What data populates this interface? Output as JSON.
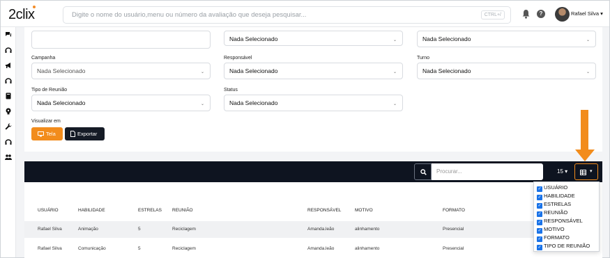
{
  "app": {
    "logo": "2clix"
  },
  "header": {
    "search_placeholder": "Digite o nome do usuário,menu ou número da avaliação que deseja pesquisar...",
    "shortcut": "CTRL+/",
    "user_name": "Rafael Silva"
  },
  "filters": {
    "row0": [
      {
        "value": ""
      },
      {
        "value": "Nada Selecionado"
      },
      {
        "value": "Nada Selecionado"
      }
    ],
    "campanha": {
      "label": "Campanha",
      "value": "Nada Selecionado"
    },
    "responsavel": {
      "label": "Responsável",
      "value": "Nada Selecionado"
    },
    "turno": {
      "label": "Turno",
      "value": "Nada Selecionado"
    },
    "tipo_reuniao": {
      "label": "Tipo de Reunião",
      "value": "Nada Selecionado"
    },
    "status": {
      "label": "Status",
      "value": "Nada Selecionado"
    },
    "visualizar_label": "Visualizar em",
    "btn_tela": "Tela",
    "btn_exportar": "Exportar"
  },
  "table": {
    "search_placeholder": "Procurar...",
    "page_size": "15",
    "columns": [
      "USUÁRIO",
      "HABILIDADE",
      "ESTRELAS",
      "REUNIÃO",
      "RESPONSÁVEL",
      "MOTIVO",
      "FORMATO"
    ],
    "rows": [
      [
        "Rafael Silva",
        "Animação",
        "5",
        "Reciclagem",
        "Amanda.leão",
        "alinhamento",
        "Presencial"
      ],
      [
        "Rafael Silva",
        "Comunicação",
        "5",
        "Reciclagem",
        "Amanda.leão",
        "alinhamento",
        "Presencial"
      ]
    ]
  },
  "column_toggle": {
    "options": [
      "USUÁRIO",
      "HABILIDADE",
      "ESTRELAS",
      "REUNIÃO",
      "RESPONSÁVEL",
      "MOTIVO",
      "FORMATO",
      "TIPO DE REUNIÃO"
    ],
    "checked": [
      true,
      true,
      true,
      true,
      true,
      true,
      true,
      true
    ]
  },
  "colors": {
    "accent": "#f28c1c",
    "dark": "#0e1420",
    "checkbox": "#1a73e8"
  }
}
